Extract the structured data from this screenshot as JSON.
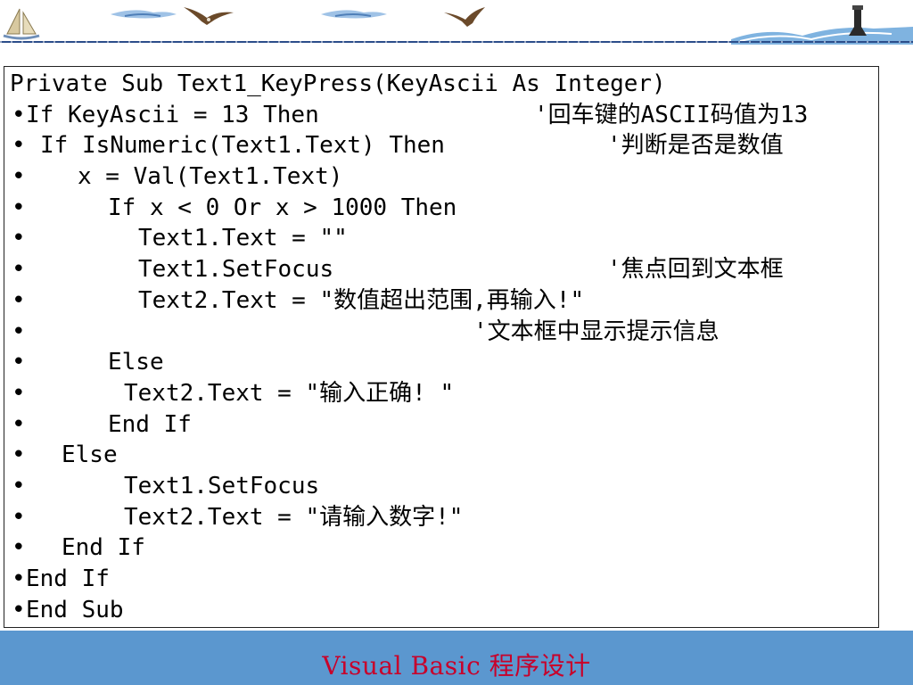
{
  "slide": {
    "footer_title": "Visual Basic 程序设计",
    "colors": {
      "footer_bg": "#5b97cf",
      "footer_text": "#c8002a",
      "header_rule": "#2c4d8a"
    },
    "header_icons": [
      "sailboat-icon",
      "cloud-icon",
      "eagle-icon",
      "cloud-icon",
      "eagle-icon",
      "lighthouse-wave-icon"
    ]
  },
  "code": {
    "lines": [
      {
        "bullet": "",
        "text": "Private Sub Text1_KeyPress(KeyAscii As Integer)",
        "comment": ""
      },
      {
        "bullet": "•",
        "text": "If KeyAscii = 13 Then",
        "comment": "'回车键的ASCII码值为13"
      },
      {
        "bullet": "•",
        "text": "If IsNumeric(Text1.Text) Then",
        "comment": "'判断是否是数值"
      },
      {
        "bullet": "•",
        "text": "x = Val(Text1.Text)",
        "comment": ""
      },
      {
        "bullet": "•",
        "text": "If x < 0 Or x > 1000 Then",
        "comment": ""
      },
      {
        "bullet": "•",
        "text": "Text1.Text = \"\"",
        "comment": ""
      },
      {
        "bullet": "•",
        "text": "Text1.SetFocus",
        "comment": "'焦点回到文本框"
      },
      {
        "bullet": "•",
        "text": "Text2.Text = \"数值超出范围,再输入!\"",
        "comment": ""
      },
      {
        "bullet": "•",
        "text": "",
        "comment": "'文本框中显示提示信息"
      },
      {
        "bullet": "•",
        "text": "Else",
        "comment": ""
      },
      {
        "bullet": "•",
        "text": "Text2.Text = \"输入正确! \"",
        "comment": ""
      },
      {
        "bullet": "•",
        "text": "End If",
        "comment": ""
      },
      {
        "bullet": "•",
        "text": "Else",
        "comment": ""
      },
      {
        "bullet": "•",
        "text": "Text1.SetFocus",
        "comment": ""
      },
      {
        "bullet": "•",
        "text": "Text2.Text = \"请输入数字!\"",
        "comment": ""
      },
      {
        "bullet": "•",
        "text": "End If",
        "comment": ""
      },
      {
        "bullet": "•",
        "text": "End If",
        "comment": ""
      },
      {
        "bullet": "•",
        "text": "End Sub",
        "comment": ""
      }
    ]
  }
}
